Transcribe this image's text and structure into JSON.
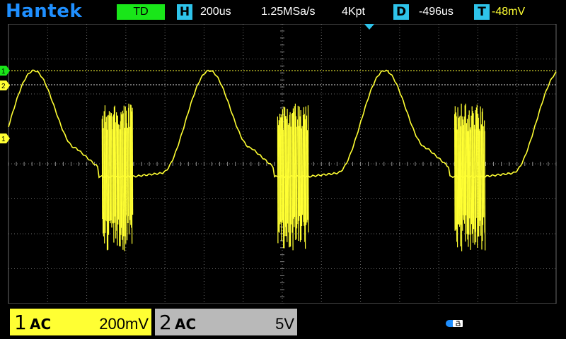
{
  "brand": "Hantek",
  "mode_label": "TD",
  "horizontal": {
    "tag": "H",
    "timebase": "200us",
    "sample_rate": "1.25MSa/s",
    "memory_depth": "4Kpt"
  },
  "delay": {
    "tag": "D",
    "value": "-496us"
  },
  "trigger": {
    "tag": "T",
    "level": "-48mV"
  },
  "channels": [
    {
      "number": "1",
      "coupling": "AC",
      "scale": "200mV",
      "color": "#ffff33"
    },
    {
      "number": "2",
      "coupling": "AC",
      "scale": "5V",
      "color": "#b9b9b9"
    }
  ],
  "markers": {
    "ch1_ground": "1",
    "ch2_ground": "2",
    "trigger_level": "1"
  },
  "colors": {
    "accent": "#2ec3ea",
    "trace": "#ffff33",
    "run_mode": "#19e619",
    "brand": "#1f8fff"
  },
  "icons": {
    "trigger_position": "triangle-down-icon",
    "usb": "usb-drive-icon"
  }
}
